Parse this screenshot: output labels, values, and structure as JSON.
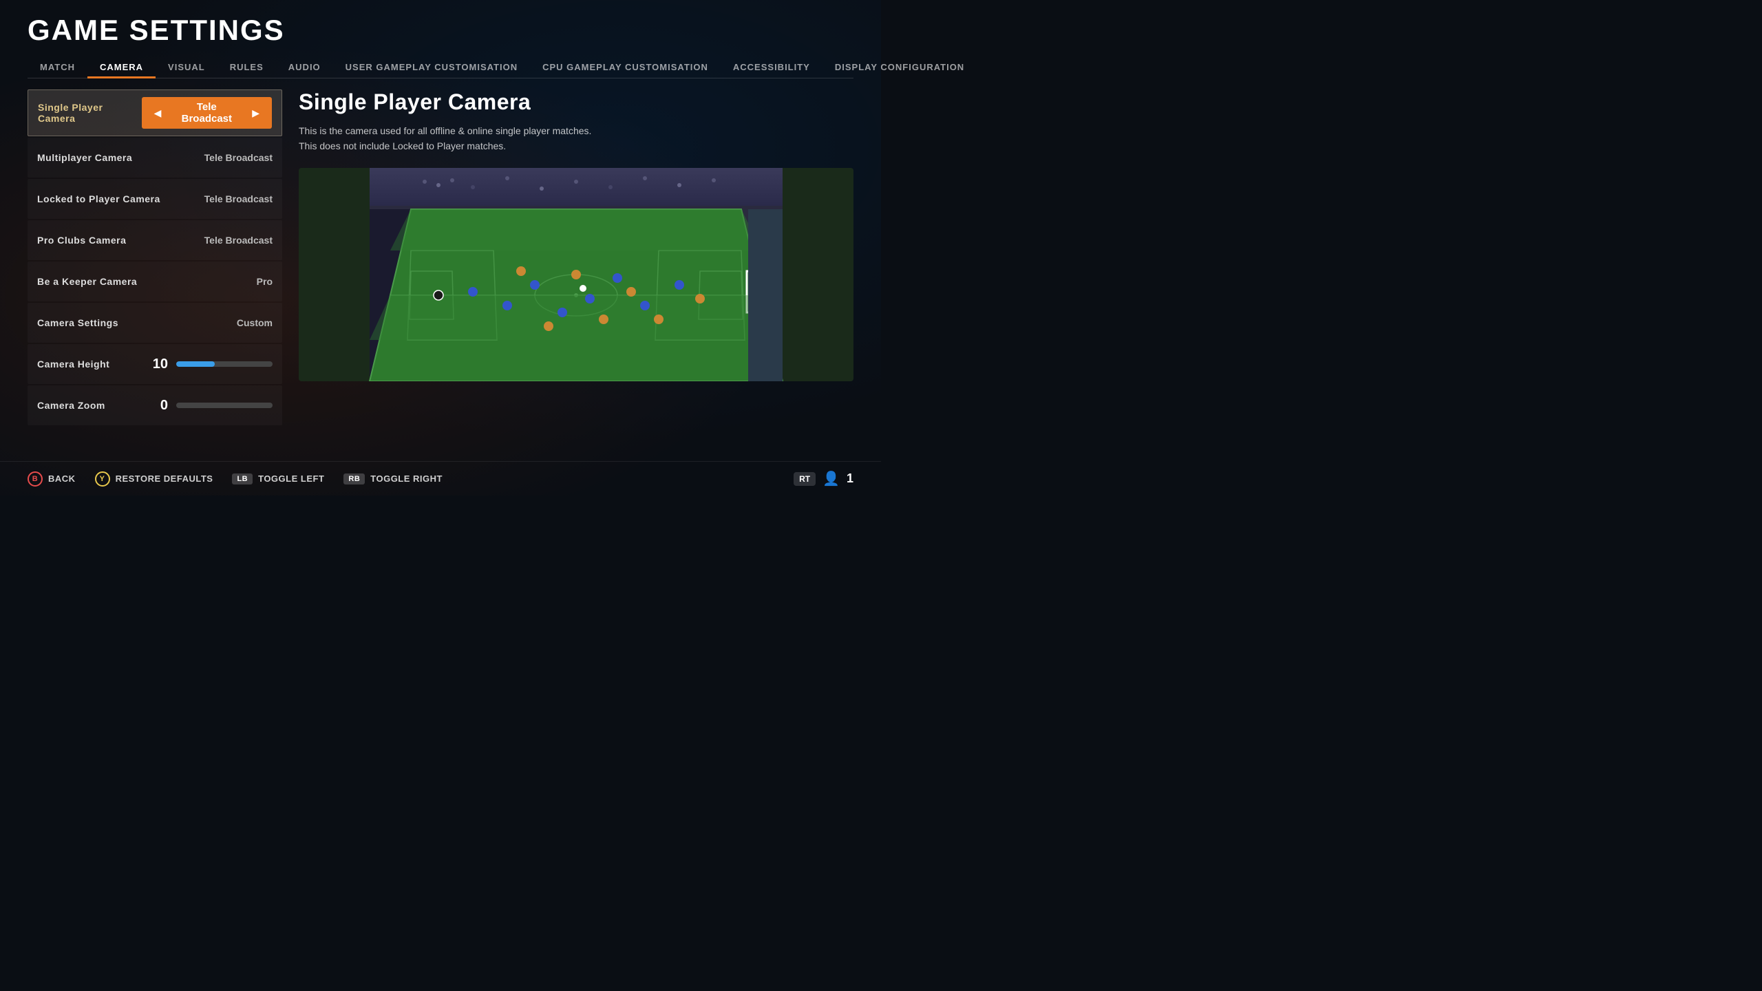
{
  "page": {
    "title": "GAME SETTINGS"
  },
  "nav": {
    "tabs": [
      {
        "id": "match",
        "label": "MATCH",
        "active": false
      },
      {
        "id": "camera",
        "label": "CAMERA",
        "active": true
      },
      {
        "id": "visual",
        "label": "VISUAL",
        "active": false
      },
      {
        "id": "rules",
        "label": "RULES",
        "active": false
      },
      {
        "id": "audio",
        "label": "AUDIO",
        "active": false
      },
      {
        "id": "user-gameplay",
        "label": "USER GAMEPLAY CUSTOMISATION",
        "active": false
      },
      {
        "id": "cpu-gameplay",
        "label": "CPU GAMEPLAY CUSTOMISATION",
        "active": false
      },
      {
        "id": "accessibility",
        "label": "ACCESSIBILITY",
        "active": false
      },
      {
        "id": "display-config",
        "label": "DISPLAY CONFIGURATION",
        "active": false
      }
    ]
  },
  "settings": {
    "rows": [
      {
        "id": "single-player-camera",
        "label": "Single Player Camera",
        "value": "Tele Broadcast",
        "type": "select",
        "active": true
      },
      {
        "id": "multiplayer-camera",
        "label": "Multiplayer Camera",
        "value": "Tele Broadcast",
        "type": "select",
        "active": false
      },
      {
        "id": "locked-to-player-camera",
        "label": "Locked to Player Camera",
        "value": "Tele Broadcast",
        "type": "select",
        "active": false
      },
      {
        "id": "pro-clubs-camera",
        "label": "Pro Clubs Camera",
        "value": "Tele Broadcast",
        "type": "select",
        "active": false
      },
      {
        "id": "be-a-keeper-camera",
        "label": "Be a Keeper Camera",
        "value": "Pro",
        "type": "select",
        "active": false
      },
      {
        "id": "camera-settings",
        "label": "Camera Settings",
        "value": "Custom",
        "type": "select",
        "active": false
      },
      {
        "id": "camera-height",
        "label": "Camera Height",
        "value": "10",
        "type": "slider",
        "fill": 40,
        "active": false
      },
      {
        "id": "camera-zoom",
        "label": "Camera Zoom",
        "value": "0",
        "type": "slider",
        "fill": 0,
        "active": false
      }
    ]
  },
  "info": {
    "title": "Single Player Camera",
    "description": "This is the camera used for all offline & online single player matches.\nThis does not include Locked to Player matches."
  },
  "footer": {
    "controls": [
      {
        "icon": "B",
        "icon_style": "red",
        "label": "Back"
      },
      {
        "icon": "Y",
        "icon_style": "yellow",
        "label": "Restore Defaults"
      },
      {
        "box": "LB",
        "label": "Toggle Left"
      },
      {
        "box": "RB",
        "label": "Toggle Right"
      }
    ],
    "rt_label": "RT",
    "player_count": "1"
  }
}
